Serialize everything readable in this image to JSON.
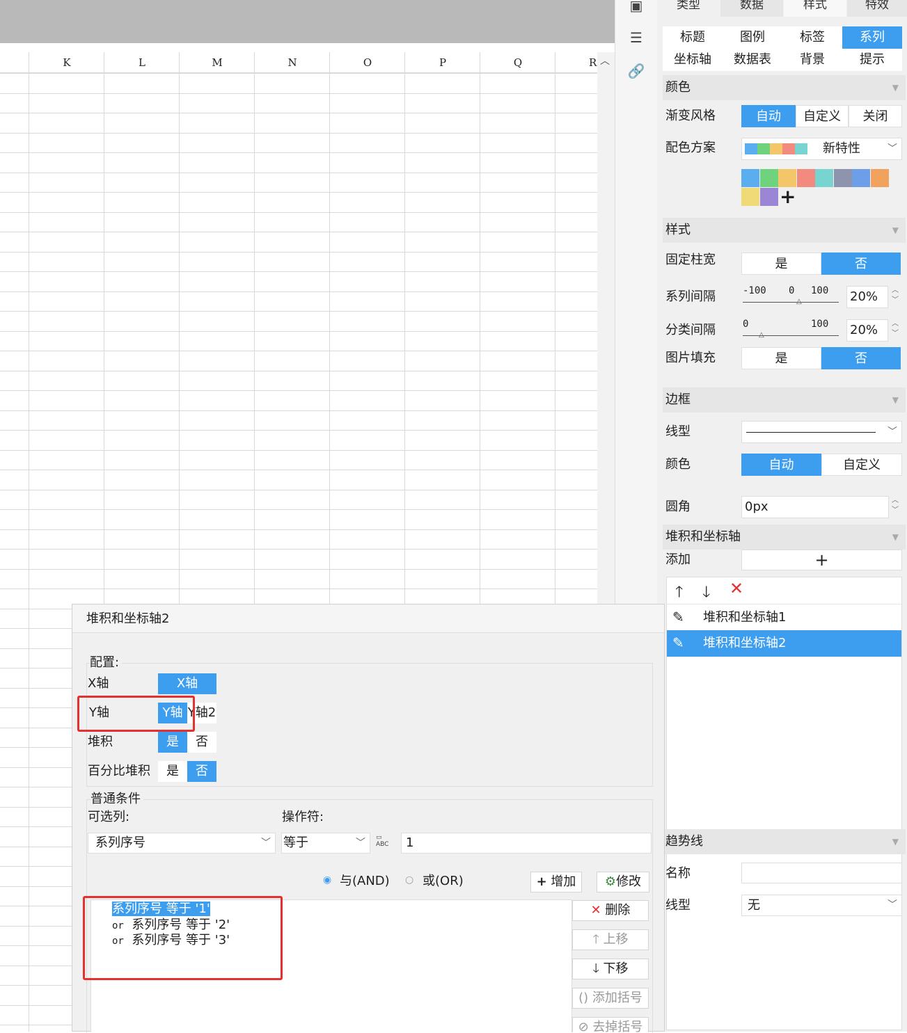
{
  "top_tabs": [
    "类型",
    "数据",
    "样式",
    "特效"
  ],
  "columns": [
    "K",
    "L",
    "M",
    "N",
    "O",
    "P",
    "Q",
    "R"
  ],
  "sub_tabs": [
    {
      "label": "标题",
      "active": false
    },
    {
      "label": "图例",
      "active": false
    },
    {
      "label": "标签",
      "active": false
    },
    {
      "label": "系列",
      "active": true
    },
    {
      "label": "坐标轴",
      "active": false
    },
    {
      "label": "数据表",
      "active": false
    },
    {
      "label": "背景",
      "active": false
    },
    {
      "label": "提示",
      "active": false
    }
  ],
  "color_section": {
    "title": "颜色",
    "gradient_label": "渐变风格",
    "gradient_options": [
      "自动",
      "自定义",
      "关闭"
    ],
    "scheme_label": "配色方案",
    "scheme_name": "新特性",
    "palette": [
      "#5aaef0",
      "#6fd27d",
      "#f5c56a",
      "#f38a80",
      "#78d4cf",
      "#8f94ae",
      "#6d9ee8",
      "#f1a35e",
      "#f0d977",
      "#9b86d6"
    ],
    "add_symbol": "+"
  },
  "style_section": {
    "title": "样式",
    "fixed_width_label": "固定柱宽",
    "series_gap_label": "系列间隔",
    "category_gap_label": "分类间隔",
    "image_fill_label": "图片填充",
    "yes": "是",
    "no": "否",
    "series_slider": {
      "min": "-100",
      "mid": "0",
      "max": "100"
    },
    "series_value": "20%",
    "category_slider": {
      "min": "0",
      "max": "100"
    },
    "category_value": "20%"
  },
  "border_section": {
    "title": "边框",
    "line_label": "线型",
    "color_label": "颜色",
    "color_options": [
      "自动",
      "自定义"
    ],
    "radius_label": "圆角",
    "radius_value": "0px"
  },
  "stack_section": {
    "title": "堆积和坐标轴",
    "add_label": "添加",
    "add_symbol": "+",
    "items": [
      "堆积和坐标轴1",
      "堆积和坐标轴2"
    ]
  },
  "trend_section": {
    "title": "趋势线",
    "name_label": "名称",
    "line_label": "线型",
    "line_value": "无"
  },
  "dialog": {
    "title": "堆积和坐标轴2",
    "config_label": "配置:",
    "x_axis_label": "X轴",
    "x_axis_value": "X轴",
    "y_axis_label": "Y轴",
    "y_axis_options": [
      "Y轴",
      "Y轴2"
    ],
    "stack_label": "堆积",
    "percent_stack_label": "百分比堆积",
    "yes": "是",
    "no": "否",
    "cond_group_label": "普通条件",
    "col_label": "可选列:",
    "op_label": "操作符:",
    "col_value": "系列序号",
    "op_value": "等于",
    "value_input": "1",
    "and_label": "与(AND)",
    "or_label": "或(OR)",
    "add_btn": "增加",
    "modify_btn": "修改",
    "conditions": [
      "系列序号 等于 '1'",
      "系列序号 等于 '2'",
      "系列序号 等于 '3'"
    ],
    "or_keyword": "or",
    "delete_btn": "删除",
    "up_btn": "上移",
    "down_btn": "下移",
    "add_bracket_btn": "添加括号",
    "remove_bracket_btn": "去掉括号"
  }
}
